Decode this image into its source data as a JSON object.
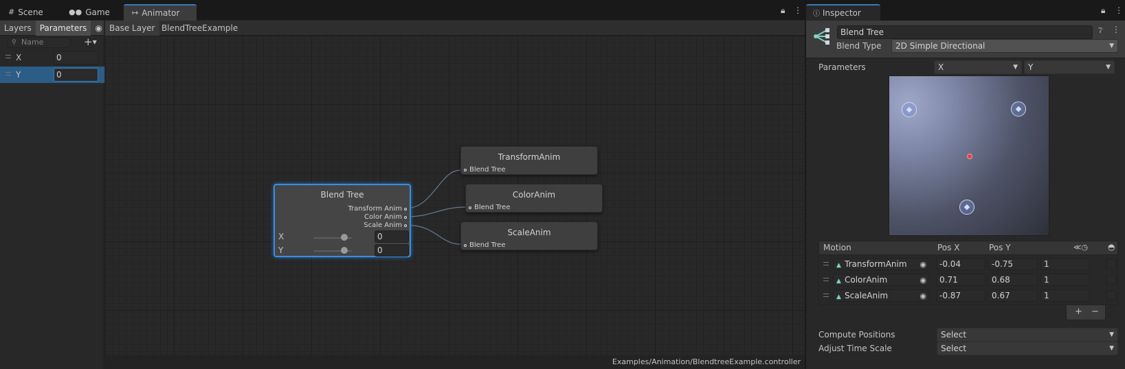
{
  "tabs": [
    {
      "label": "Scene",
      "icon": "grid-icon"
    },
    {
      "label": "Game",
      "icon": "gamepad-icon"
    },
    {
      "label": "Animator",
      "icon": "animator-icon"
    }
  ],
  "sidebar": {
    "tabs": [
      "Layers",
      "Parameters"
    ],
    "search_placeholder": "Name",
    "params": [
      {
        "name": "X",
        "value": "0"
      },
      {
        "name": "Y",
        "value": "0"
      }
    ]
  },
  "breadcrumb": [
    "Base Layer",
    "BlendTreeExample"
  ],
  "status_path": "Examples/Animation/BlendtreeExample.controller",
  "graph": {
    "blend_tree": {
      "title": "Blend Tree",
      "outputs": [
        "Transform Anim",
        "Color Anim",
        "Scale Anim"
      ],
      "params": [
        {
          "name": "X",
          "value": "0",
          "level": 0.8
        },
        {
          "name": "Y",
          "value": "0",
          "level": 0.8
        }
      ]
    },
    "clips": [
      {
        "title": "TransformAnim",
        "port": "Blend Tree"
      },
      {
        "title": "ColorAnim",
        "port": "Blend Tree"
      },
      {
        "title": "ScaleAnim",
        "port": "Blend Tree"
      }
    ]
  },
  "inspector": {
    "tab_label": "Inspector",
    "name": "Blend Tree",
    "blend_type_label": "Blend Type",
    "blend_type": "2D Simple Directional",
    "parameters_label": "Parameters",
    "param_x": "X",
    "param_y": "Y",
    "motion_header": {
      "motion": "Motion",
      "posx": "Pos X",
      "posy": "Pos Y"
    },
    "motions": [
      {
        "name": "TransformAnim",
        "posx": "-0.04",
        "posy": "-0.75",
        "speed": "1"
      },
      {
        "name": "ColorAnim",
        "posx": "0.71",
        "posy": "0.68",
        "speed": "1"
      },
      {
        "name": "ScaleAnim",
        "posx": "-0.87",
        "posy": "0.67",
        "speed": "1"
      }
    ],
    "add_symbol": "+",
    "remove_symbol": "−",
    "compute_positions_label": "Compute Positions",
    "compute_positions_value": "Select",
    "adjust_time_scale_label": "Adjust Time Scale",
    "adjust_time_scale_value": "Select"
  }
}
